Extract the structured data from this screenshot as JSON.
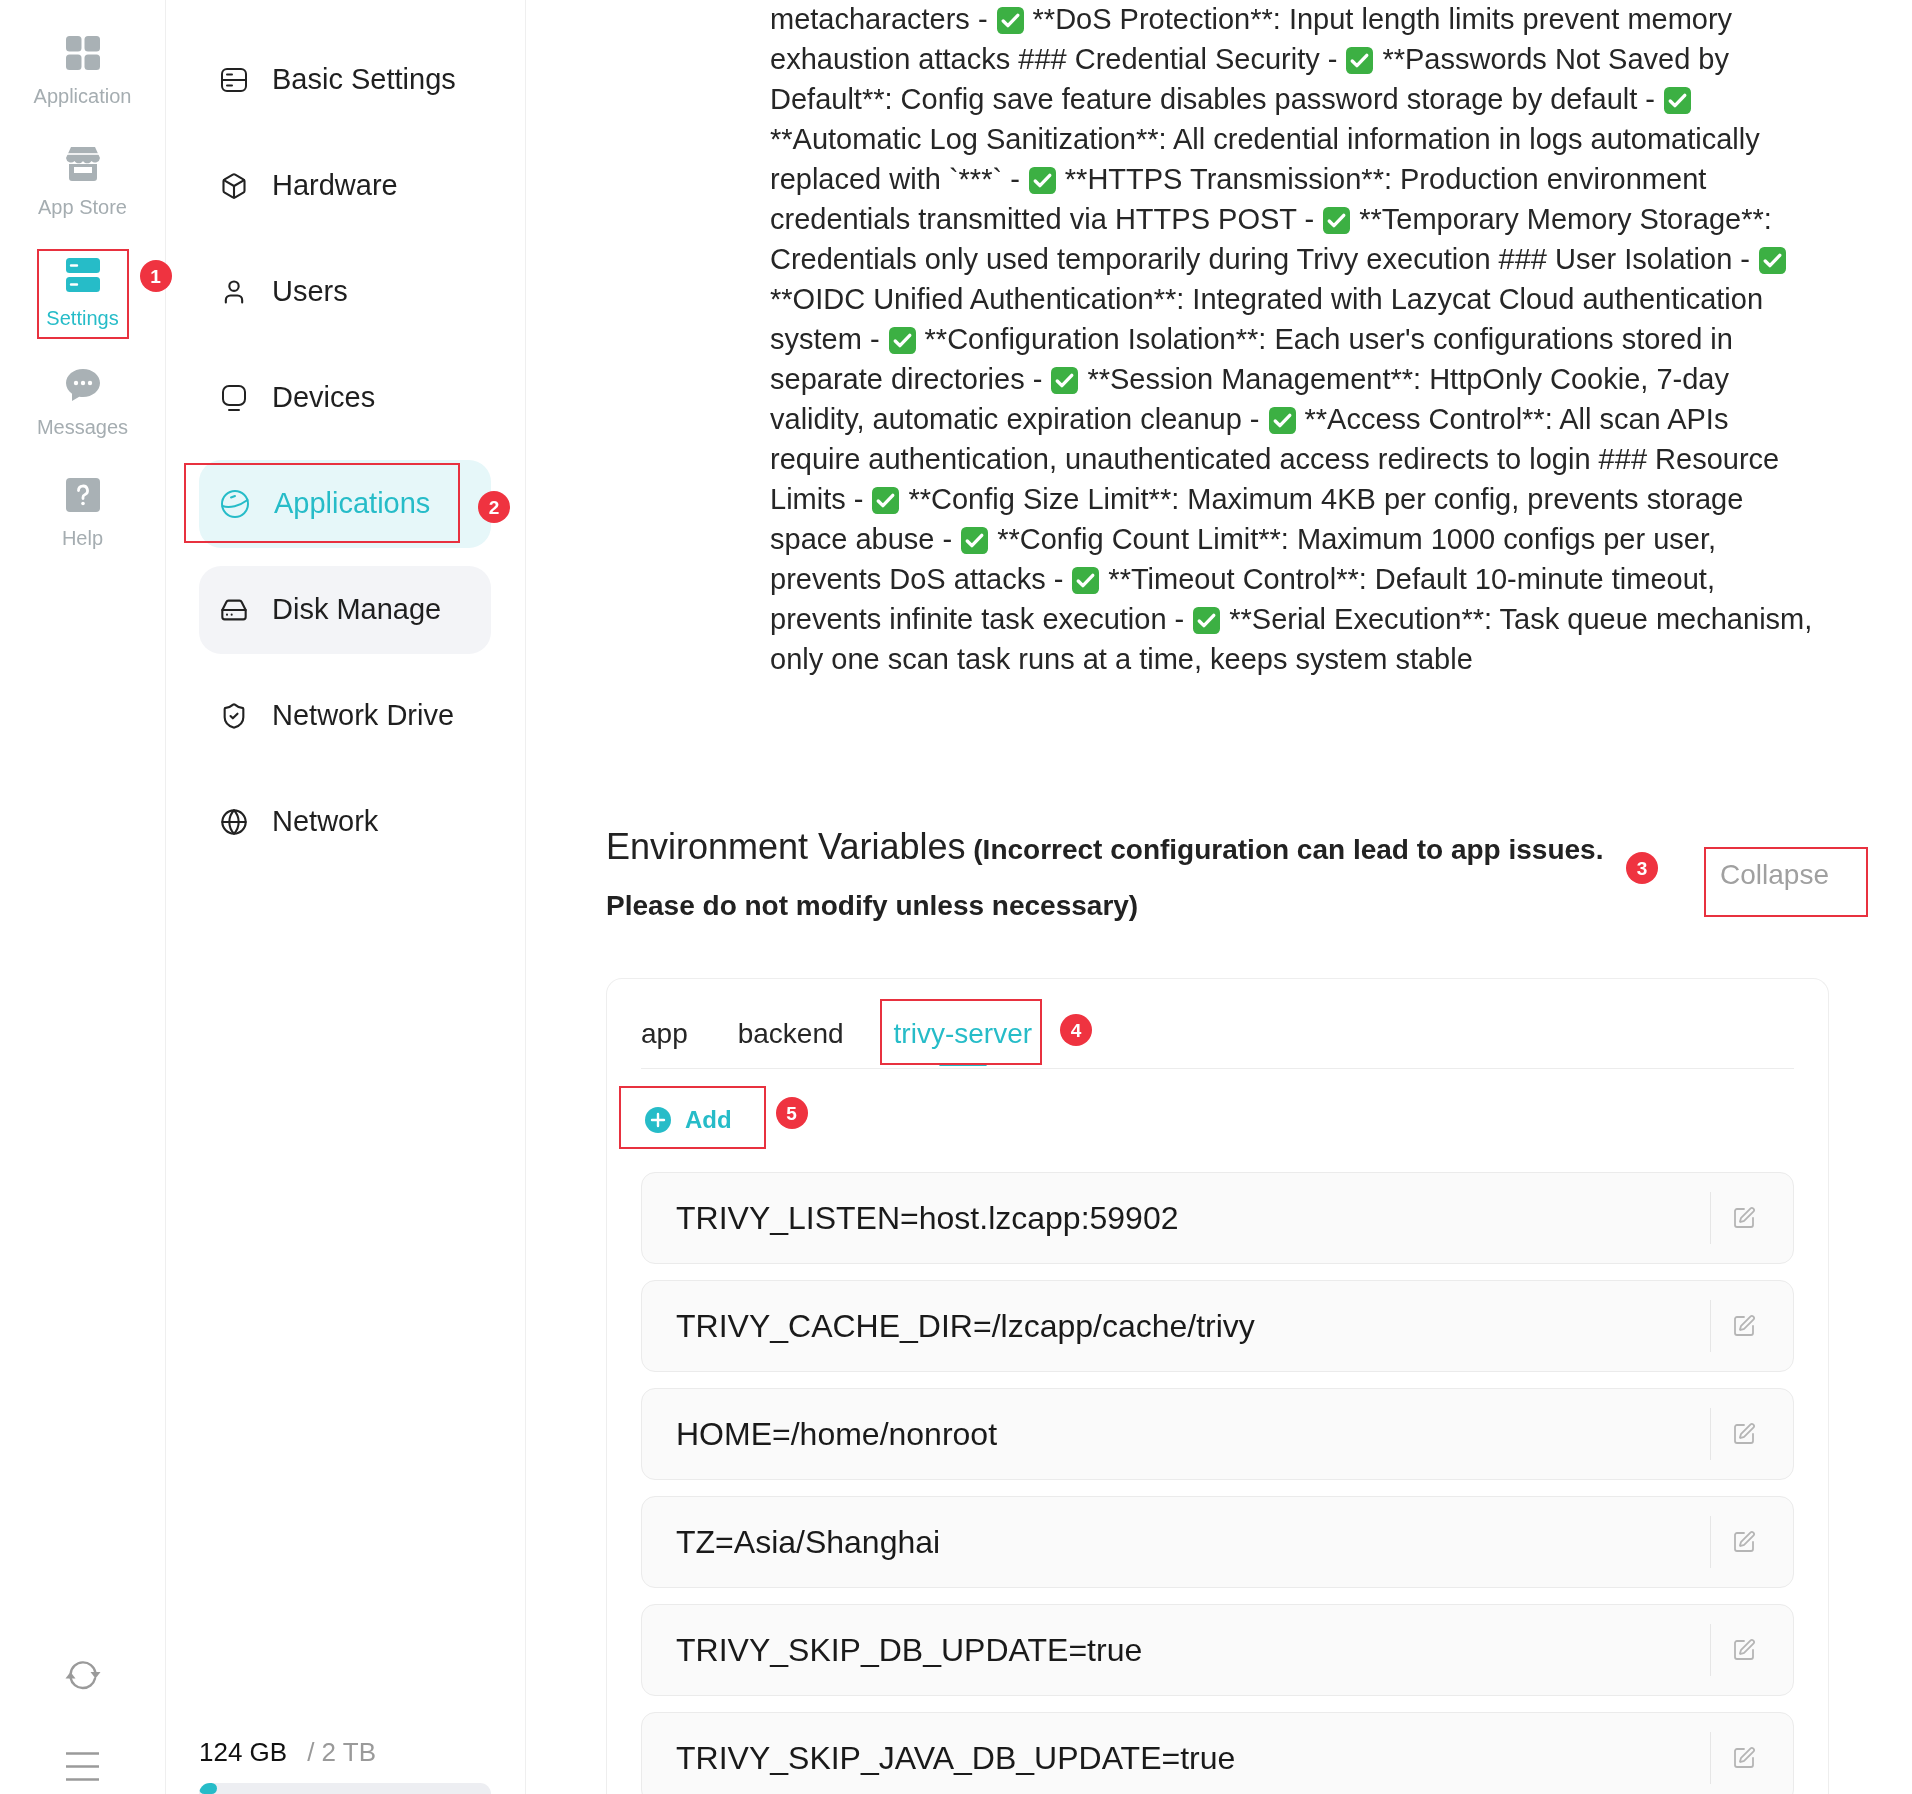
{
  "rail": {
    "items": [
      {
        "label": "Application",
        "selected": false
      },
      {
        "label": "App Store",
        "selected": false
      },
      {
        "label": "Settings",
        "selected": true,
        "annotation": "1"
      },
      {
        "label": "Messages",
        "selected": false
      },
      {
        "label": "Help",
        "selected": false
      }
    ]
  },
  "sidebar": {
    "items": [
      {
        "label": "Basic Settings",
        "selected": false,
        "hovered": false
      },
      {
        "label": "Hardware",
        "selected": false,
        "hovered": false
      },
      {
        "label": "Users",
        "selected": false,
        "hovered": false
      },
      {
        "label": "Devices",
        "selected": false,
        "hovered": false
      },
      {
        "label": "Applications",
        "selected": true,
        "hovered": false,
        "annotation": "2"
      },
      {
        "label": "Disk Manage",
        "selected": false,
        "hovered": true
      },
      {
        "label": "Network Drive",
        "selected": false,
        "hovered": false
      },
      {
        "label": "Network",
        "selected": false,
        "hovered": false
      }
    ],
    "storage": {
      "used": "124 GB",
      "total": "/ 2 TB",
      "level": 0.06
    }
  },
  "description": {
    "lines": [
      [
        {
          "kind": "text",
          "text": "metacharacters -"
        },
        {
          "kind": "check"
        },
        {
          "kind": "text",
          "text": "**DoS Protection**: Input length limits prevent memory"
        }
      ],
      [
        {
          "kind": "text",
          "text": "exhaustion attacks ### Credential Security -"
        },
        {
          "kind": "check"
        },
        {
          "kind": "text",
          "text": "**Passwords Not Saved by"
        }
      ],
      [
        {
          "kind": "text",
          "text": "Default**: Config save feature disables password storage by default -"
        },
        {
          "kind": "check"
        }
      ],
      [
        {
          "kind": "text",
          "text": "**Automatic Log Sanitization**: All credential information in logs automatically"
        }
      ],
      [
        {
          "kind": "text",
          "text": "replaced with `***` -"
        },
        {
          "kind": "check"
        },
        {
          "kind": "text",
          "text": "**HTTPS Transmission**: Production environment"
        }
      ],
      [
        {
          "kind": "text",
          "text": "credentials transmitted via HTTPS POST -"
        },
        {
          "kind": "check"
        },
        {
          "kind": "text",
          "text": "**Temporary Memory Storage**:"
        }
      ],
      [
        {
          "kind": "text",
          "text": "Credentials only used temporarily during Trivy execution ### User Isolation -"
        },
        {
          "kind": "check"
        }
      ],
      [
        {
          "kind": "text",
          "text": "**OIDC Unified Authentication**: Integrated with Lazycat Cloud authentication"
        }
      ],
      [
        {
          "kind": "text",
          "text": "system -"
        },
        {
          "kind": "check"
        },
        {
          "kind": "text",
          "text": "**Configuration Isolation**: Each user's configurations stored in"
        }
      ],
      [
        {
          "kind": "text",
          "text": "separate directories -"
        },
        {
          "kind": "check"
        },
        {
          "kind": "text",
          "text": "**Session Management**: HttpOnly Cookie, 7-day"
        }
      ],
      [
        {
          "kind": "text",
          "text": "validity, automatic expiration cleanup -"
        },
        {
          "kind": "check"
        },
        {
          "kind": "text",
          "text": "**Access Control**: All scan APIs"
        }
      ],
      [
        {
          "kind": "text",
          "text": "require authentication, unauthenticated access redirects to login ### Resource"
        }
      ],
      [
        {
          "kind": "text",
          "text": "Limits -"
        },
        {
          "kind": "check"
        },
        {
          "kind": "text",
          "text": "**Config Size Limit**: Maximum 4KB per config, prevents storage"
        }
      ],
      [
        {
          "kind": "text",
          "text": "space abuse -"
        },
        {
          "kind": "check"
        },
        {
          "kind": "text",
          "text": "**Config Count Limit**: Maximum 1000 configs per user,"
        }
      ],
      [
        {
          "kind": "text",
          "text": "prevents DoS attacks -"
        },
        {
          "kind": "check"
        },
        {
          "kind": "text",
          "text": "**Timeout Control**: Default 10-minute timeout,"
        }
      ],
      [
        {
          "kind": "text",
          "text": "prevents infinite task execution -"
        },
        {
          "kind": "check"
        },
        {
          "kind": "text",
          "text": "**Serial Execution**: Task queue mechanism,"
        }
      ],
      [
        {
          "kind": "text",
          "text": "only one scan task runs at a time, keeps system stable"
        }
      ]
    ]
  },
  "env": {
    "title": "Environment Variables",
    "warning": "(Incorrect configuration can lead to app issues. Please do not modify unless necessary)",
    "collapse": {
      "label": "Collapse",
      "annotation": "3"
    },
    "tabs": [
      {
        "label": "app",
        "selected": false
      },
      {
        "label": "backend",
        "selected": false
      },
      {
        "label": "trivy-server",
        "selected": true,
        "annotation": "4"
      }
    ],
    "add": {
      "label": "Add",
      "annotation": "5"
    },
    "variables": [
      "TRIVY_LISTEN=host.lzcapp:59902",
      "TRIVY_CACHE_DIR=/lzcapp/cache/trivy",
      "HOME=/home/nonroot",
      "TZ=Asia/Shanghai",
      "TRIVY_SKIP_DB_UPDATE=true",
      "TRIVY_SKIP_JAVA_DB_UPDATE=true"
    ]
  }
}
